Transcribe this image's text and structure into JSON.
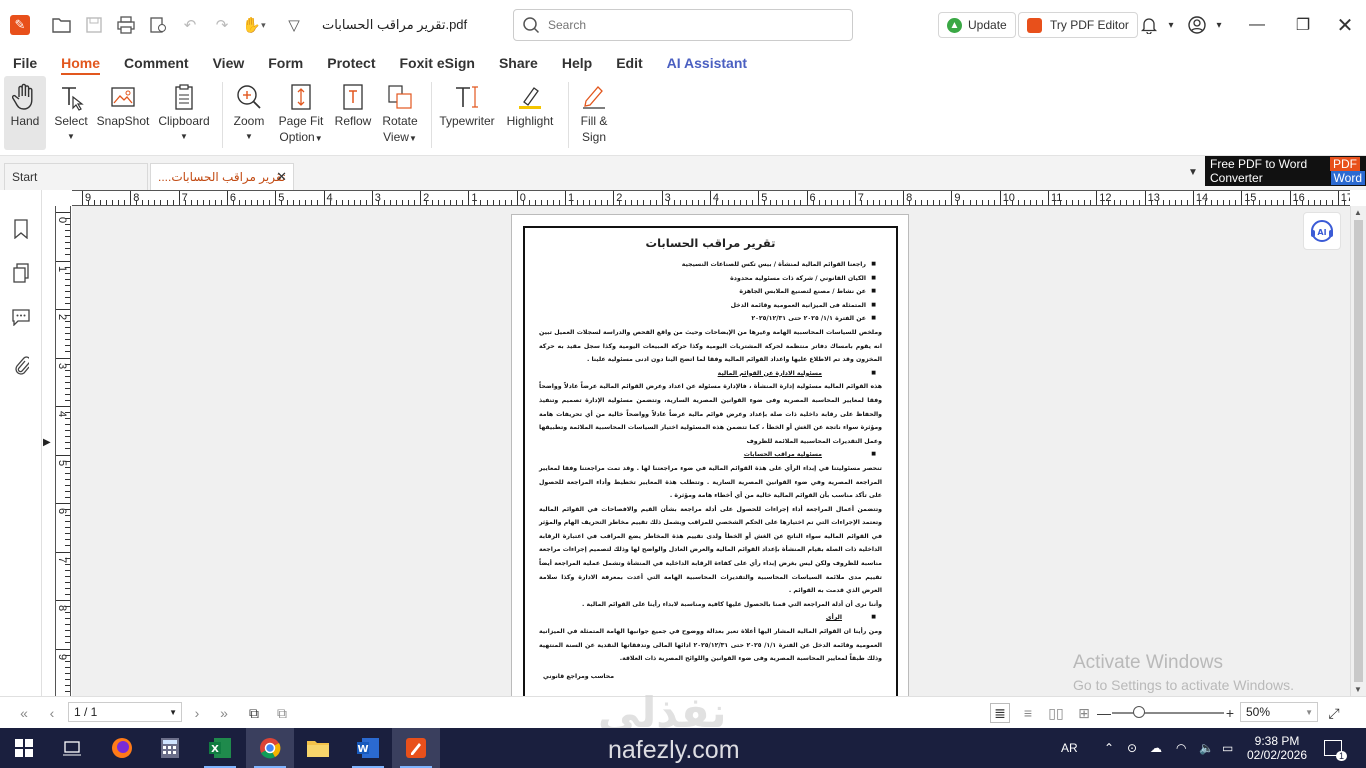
{
  "titlebar": {
    "doc_title": "تقرير مراقب الحسابات.pdf",
    "search_placeholder": "Search",
    "update_label": "Update",
    "try_editor_label": "Try PDF Editor"
  },
  "menu": {
    "items": [
      "File",
      "Home",
      "Comment",
      "View",
      "Form",
      "Protect",
      "Foxit eSign",
      "Share",
      "Help",
      "Edit",
      "AI Assistant"
    ],
    "active": "Home"
  },
  "ribbon": {
    "hand": "Hand",
    "select": "Select",
    "snapshot": "SnapShot",
    "clipboard": "Clipboard",
    "zoom": "Zoom",
    "page_fit_1": "Page Fit",
    "page_fit_2": "Option",
    "reflow": "Reflow",
    "rotate_1": "Rotate",
    "rotate_2": "View",
    "typewriter": "Typewriter",
    "highlight": "Highlight",
    "fill_1": "Fill &",
    "fill_2": "Sign"
  },
  "tabs": {
    "start": "Start",
    "doc": "تقرير مراقب الحسابات...."
  },
  "ad": {
    "line1": "Free PDF to Word",
    "line2": "Converter",
    "pdf": "PDF",
    "word": "Word"
  },
  "ruler": {
    "h_numbers": [
      "9",
      "8",
      "7",
      "6",
      "5",
      "4",
      "3",
      "2",
      "1",
      "0",
      "1",
      "2",
      "3",
      "4",
      "5",
      "6",
      "7",
      "8",
      "9",
      "10",
      "11",
      "12",
      "13",
      "14",
      "15",
      "16",
      "17"
    ],
    "v_numbers": [
      "0",
      "1",
      "2",
      "3",
      "4",
      "5",
      "6",
      "7",
      "8",
      "9"
    ]
  },
  "page": {
    "title": "تقرير مراقب الحسابات",
    "bullets": [
      "راجعنا القوائم المالية لمنشأة / بيس تكس للصناعات النسيجية",
      "الكيان القانوني / شركة ذات مسئولية محدودة",
      "عن نشاط / مصنع لتصنيع الملابس الجاهزة",
      "المتمثلة فى الميزانية العمومية وقائمة الدخل",
      "عن الفترة ١/١/ ٢٠٢٥ حتى ٢٠٢٥/١٢/٣١"
    ],
    "para1": "وملخص للسياسات المحاسبية الهامة وغيرها من الإيضاحات وحيث من واقع الفحص والدراسة لسجلات العميل تبين انه يقوم بامساك دفاتر منتظمة لحركة المشتريات اليومية وكذا حركة المبيعات اليومية وكذا سجل مقيد به حركة المخزون وقد تم الاطلاع عليها واعداد القوائم المالية وفقا لما اتضح الينا دون ادنى مسئولية علينا .",
    "head1": "مسئولية الادارة عن القوائم المالية",
    "para2": "هذه القوائم المالية مسئولية إدارة المنشأة ، فالإدارة مسئولة عن اعداد وعرض القوائم المالية عرضاً عادلاً وواضحاً وفقا لمعايير المحاسبة المصرية وفى ضوء القوانين المصرية السارية، وتتضمن مسئولية الإدارة تصميم وتنفيذ والحفاظ على رقابة داخلية ذات صلة بإعداد وعرض قوائم مالية عرضاً عادلاً وواضحاً خالية من أي تحريفات هامة ومؤثرة سواء ناتجة عن الغش أو الخطأ ، كما تتضمن هذه المسئولية اختيار السياسات المحاسبية الملائمة وتطبيقها وعمل التقديرات المحاسبية الملائمة للظروف",
    "head2": "مسئولية مراقب الحسابات",
    "para3": "تنحصر مسئوليتنا في إبداء الرأي على هذة القوائم المالية في ضوء مراجعتنا لها . وقد تمت مراجعتنا وفقا لمعايير المراجعة المصرية وفي ضوء القوانين المصرية السارية . وتتطلب هذة المعايير تخطيط وأداء المراجعة للحصول على تأكد مناسب بأن القوائم المالية خالية من أي أخطاء هامة ومؤثرة .",
    "para4": "وتتضمن أعمال المراجعة أداء إجراءات للحصول على أدلة مراجعة بشأن القيم والافصاحات في القوائم المالية وتعتمد الإجراءات التي تم اختيارها على الحكم الشخصي للمراقب ويشمل ذلك تقييم مخاطر التحريف الهام والمؤثر في القوائم المالية سواء الناتج عن الغش أو الخطأ ولدى تقييم هذة المخاطر يضع المراقب في اعتبارة الرقابة الداخلية ذات الصلة بقيام المنشأة بإعداد القوائم المالية والعرض العادل والواضح لها وذلك لتصميم إجراءات مراجعة مناسبة للظروف ولكن ليس بغرض إبداء رأي على كفاءة الرقابة الداخلية في المنشأة وتشمل عملية المراجعة أيضاً تقييم مدى ملائمة السياسات المحاسبية والتقديرات المحاسبية الهامة التي أعدت بمعرفة الادارة وكذا سلامة العرض الذي قدمت به القوائم .",
    "para5": "وأننا نرى أن أدلة المراجعة التي قمنا بالحصول عليها كافية ومناسبة لابداء رأينا على القوائم المالية .",
    "head3": "الرأى",
    "para6": "ومن رأينا ان القوائم المالية المشار اليها أعلاة تعبر بعدالة ووضوح في جميع جوانبها الهامة المتمثلة في الميزانية العمومية وقائمة الدخل عن الفترة ١/١/ ٢٠٢٥ حتى ٢٠٢٥/١٢/٣١ ادائها المالى وتدفقاتها النقدية عن السنة المنتهية وذلك طبقاً لمعايير المحاسبة المصرية وفى ضوء القوانين واللوائح المصرية ذات العلاقة.",
    "signature": "محاسب ومراجع قانوني"
  },
  "watermark": {
    "activate": "Activate Windows",
    "activate_sub": "Go to Settings to activate Windows.",
    "logo": "نفذلي",
    "url": "nafezly.com"
  },
  "status": {
    "page_value": "1 / 1",
    "zoom_value": "50%",
    "zoom_level_percent": 50
  },
  "taskbar": {
    "lang": "AR",
    "time": "9:38 PM",
    "date": "02/02/2026",
    "notif_count": "1"
  }
}
